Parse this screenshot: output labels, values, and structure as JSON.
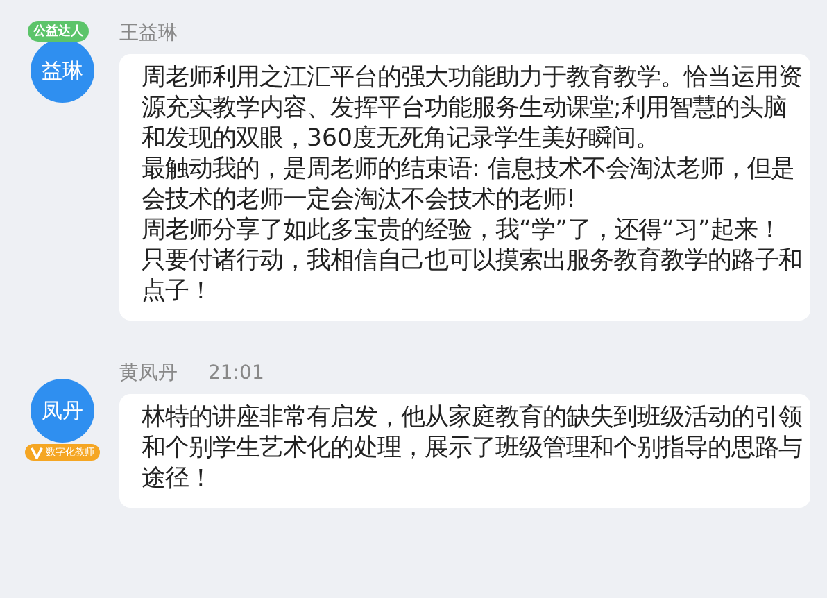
{
  "messages": [
    {
      "avatar_text": "益琳",
      "badge": "公益达人",
      "kind": "ribbon",
      "sender": "王益琳",
      "paragraphs": [
        "周老师利用之江汇平台的强大功能助力于教育教学。恰当运用资源充实教学内容、发挥平台功能服务生动课堂;利用智慧的头脑和发现的双眼，360度无死角记录学生美好瞬间。",
        "最触动我的，是周老师的结束语: 信息技术不会淘汰老师，但是会技术的老师一定会淘汰不会技术的老师!",
        "周老师分享了如此多宝贵的经验，我“学”了，还得“习”起来！只要付诸行动，我相信自己也可以摸索出服务教育教学的路子和点子！"
      ]
    },
    {
      "avatar_text": "凤丹",
      "badge": "数字化教师",
      "kind": "pill",
      "sender": "黄凤丹",
      "time": "21:01",
      "paragraphs": [
        "林特的讲座非常有启发，他从家庭教育的缺失到班级活动的引领和个别学生艺术化的处理，展示了班级管理和个别指导的思路与途径！"
      ]
    }
  ]
}
